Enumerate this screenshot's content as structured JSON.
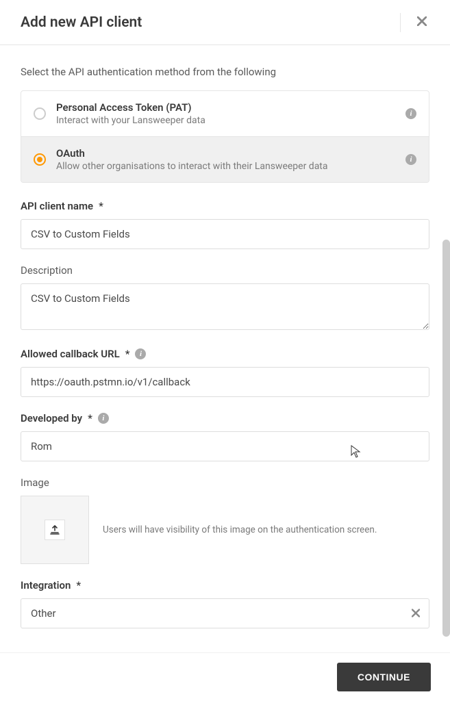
{
  "modal": {
    "title": "Add new API client",
    "intro": "Select the API authentication method from the following",
    "continue_label": "CONTINUE"
  },
  "auth_options": [
    {
      "title": "Personal Access Token (PAT)",
      "desc": "Interact with your Lansweeper data",
      "selected": false
    },
    {
      "title": "OAuth",
      "desc": "Allow other organisations to interact with their Lansweeper data",
      "selected": true
    }
  ],
  "form": {
    "client_name": {
      "label": "API client name",
      "required": "*",
      "value": "CSV to Custom Fields"
    },
    "description": {
      "label": "Description",
      "value": "CSV to Custom Fields"
    },
    "callback_url": {
      "label": "Allowed callback URL",
      "required": "*",
      "value": "https://oauth.pstmn.io/v1/callback"
    },
    "developed_by": {
      "label": "Developed by",
      "required": "*",
      "value": "Rom"
    },
    "image": {
      "label": "Image",
      "hint": "Users will have visibility of this image on the authentication screen."
    },
    "integration": {
      "label": "Integration",
      "required": "*",
      "value": "Other"
    }
  }
}
